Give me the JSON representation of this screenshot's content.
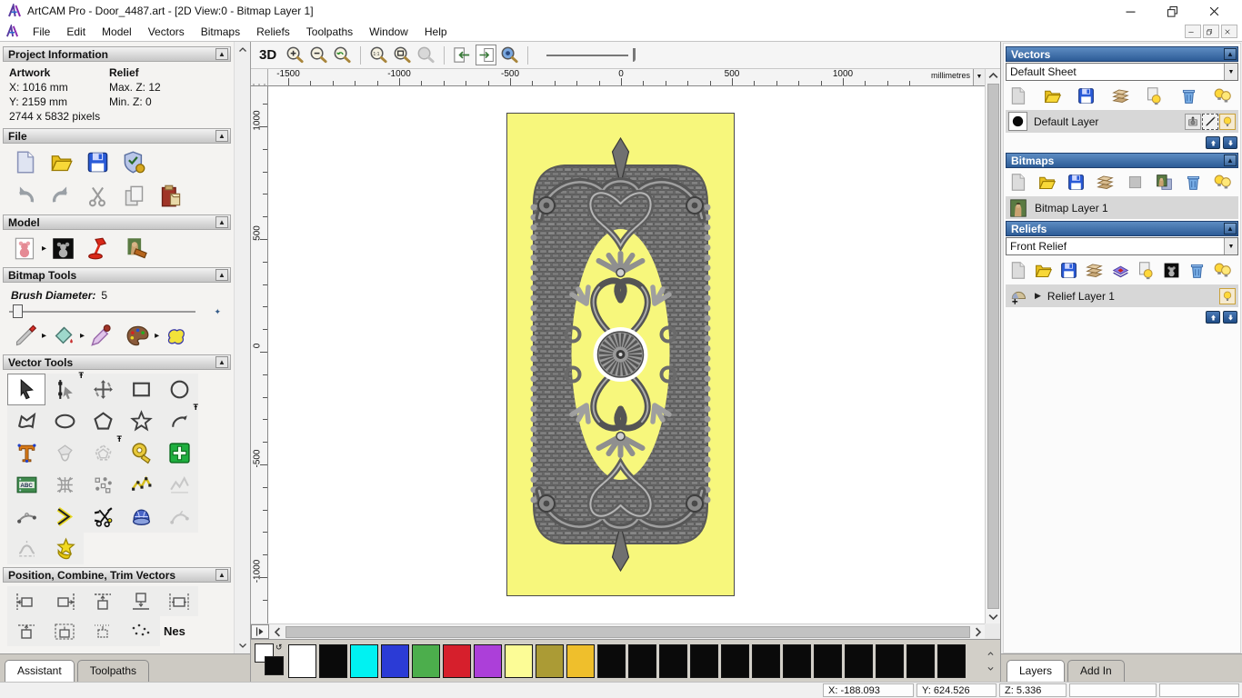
{
  "window": {
    "title": "ArtCAM Pro - Door_4487.art - [2D View:0 - Bitmap Layer 1]"
  },
  "menu": {
    "items": [
      "File",
      "Edit",
      "Model",
      "Vectors",
      "Bitmaps",
      "Reliefs",
      "Toolpaths",
      "Window",
      "Help"
    ]
  },
  "assistant": {
    "project_information": {
      "title": "Project Information",
      "artwork_label": "Artwork",
      "relief_label": "Relief",
      "artwork_x": "X: 1016 mm",
      "artwork_y": "Y: 2159 mm",
      "artwork_pixels": "2744 x 5832 pixels",
      "relief_max_z": "Max. Z: 12",
      "relief_min_z": "Min. Z: 0"
    },
    "file": {
      "title": "File",
      "icons_row1": [
        "new-file",
        "open-folder",
        "floppy-save",
        "model-options"
      ],
      "icons_row2": [
        "undo",
        "redo",
        "cut",
        "copy",
        "paste"
      ]
    },
    "model": {
      "title": "Model",
      "icons": [
        "greyscale-model",
        "fly",
        "inverse-model",
        "lighting",
        "texture-relief"
      ]
    },
    "bitmap_tools": {
      "title": "Bitmap Tools",
      "brush_label": "Brush Diameter:",
      "brush_value": "5",
      "icons": [
        "paint-brush",
        "fly",
        "flood-fill",
        "fly",
        "colour-picker",
        "palette",
        "fly",
        "magic-texture"
      ]
    },
    "vector_tools": {
      "title": "Vector Tools",
      "rows": [
        [
          {
            "icon": "cursor-arrow",
            "state": "active"
          },
          {
            "icon": "node-edit",
            "state": "pin"
          },
          {
            "icon": "transform"
          },
          {
            "icon": "rect-tool"
          },
          {
            "icon": "circle-tool"
          }
        ],
        [
          {
            "icon": "freehand"
          },
          {
            "icon": "ellipse-tool"
          },
          {
            "icon": "polygon-tool"
          },
          {
            "icon": "star-tool"
          },
          {
            "icon": "arc-tool",
            "state": "pin"
          }
        ],
        [
          {
            "icon": "text-tool"
          },
          {
            "icon": "pour-gray"
          },
          {
            "icon": "offset-gray",
            "state": "pin"
          },
          {
            "icon": "measure-tape"
          },
          {
            "icon": "green-cross"
          }
        ],
        [
          {
            "icon": "abc-block"
          },
          {
            "icon": "distort-grid"
          },
          {
            "icon": "nesting-dots"
          },
          {
            "icon": "fit-polyline"
          },
          {
            "icon": "gray-mountains"
          }
        ],
        [
          {
            "icon": "arc-fit"
          },
          {
            "icon": "join-vectors"
          },
          {
            "icon": "trim-scissors"
          },
          {
            "icon": "spin-tool"
          },
          {
            "icon": "gray-curve"
          }
        ],
        [
          {
            "icon": "section-gray"
          },
          {
            "icon": "wrap-star"
          }
        ]
      ]
    },
    "position_tools": {
      "title": "Position, Combine, Trim Vectors",
      "row1": [
        "align-left",
        "align-right",
        "align-top",
        "align-bottom",
        "align-center-h"
      ],
      "row2": [
        "align-top-sq",
        "align-top-dash",
        "align-top-dot",
        "scatter-small"
      ],
      "nesting_label": "Nes"
    },
    "tabs": [
      {
        "label": "Assistant"
      },
      {
        "label": "Toolpaths"
      }
    ]
  },
  "canvas": {
    "toolbar": {
      "view_label": "3D",
      "icons": [
        "zoom-in",
        "zoom-out",
        "zoom-last",
        "sep",
        "zoom-11",
        "zoom-obj",
        "zoom-gray",
        "sep",
        "pan-left",
        "pan-right!",
        "preview-eye",
        "sep"
      ]
    },
    "ruler_unit": "millimetres",
    "h_ticks": [
      "-1500",
      "-1000",
      "-500",
      "0",
      "500",
      "1000"
    ],
    "v_ticks": [
      "1000",
      "500",
      "0",
      "-500",
      "-1000"
    ]
  },
  "layers_panel": {
    "vectors": {
      "title": "Vectors",
      "sheet": "Default Sheet",
      "icons": [
        "page-gray",
        "open-folder",
        "floppy-save",
        "merge-layers",
        "bulb-page",
        "trash",
        "bulbs-all"
      ],
      "layer_name": "Default Layer"
    },
    "bitmaps": {
      "title": "Bitmaps",
      "icons": [
        "page-gray",
        "open-folder",
        "floppy-save",
        "merge-layers",
        "gray-square",
        "mona-copy",
        "trash",
        "bulbs-all"
      ],
      "layer_name": "Bitmap Layer 1"
    },
    "reliefs": {
      "title": "Reliefs",
      "relief": "Front Relief",
      "icons": [
        "page-gray",
        "open-folder",
        "floppy-save",
        "merge-layers",
        "layers-stack",
        "bulb-page",
        "teddy-black",
        "trash",
        "bulbs-all"
      ],
      "layer_name": "Relief Layer 1"
    },
    "tabs": [
      {
        "label": "Layers"
      },
      {
        "label": "Add In"
      }
    ]
  },
  "palette": {
    "colors": [
      "#FFFFFF",
      "#0A0A0A",
      "#00F2F2",
      "#2B3BD6",
      "#4CAE4C",
      "#D61F2C",
      "#AC3FD9",
      "#FCFC96",
      "#AB9B35",
      "#EFBF2C",
      "#0A0A0A",
      "#0A0A0A",
      "#0A0A0A",
      "#0A0A0A",
      "#0A0A0A",
      "#0A0A0A",
      "#0A0A0A",
      "#0A0A0A",
      "#0A0A0A",
      "#0A0A0A",
      "#0A0A0A",
      "#0A0A0A"
    ]
  },
  "status": {
    "x": "X: -188.093",
    "y": "Y: 624.526",
    "z": "Z: 5.336"
  }
}
